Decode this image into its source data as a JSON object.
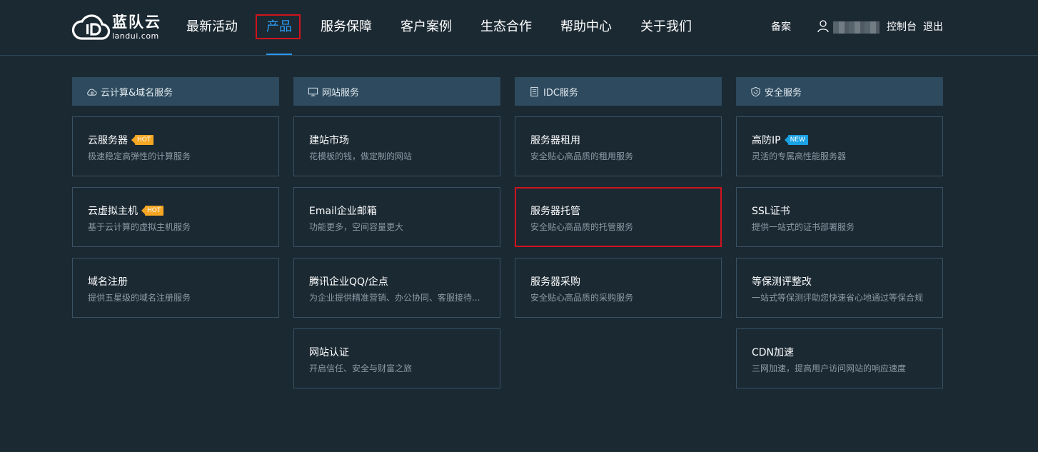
{
  "brand": {
    "name_cn": "蓝队云",
    "name_en": "landui.com"
  },
  "nav": {
    "items": [
      "最新活动",
      "产品",
      "服务保障",
      "客户案例",
      "生态合作",
      "帮助中心",
      "关于我们"
    ],
    "active": "产品"
  },
  "top_right": {
    "record": "备案",
    "console": "控制台",
    "logout": "退出"
  },
  "columns": [
    {
      "title": "云计算&域名服务",
      "icon": "cloud-gear-icon",
      "cards": [
        {
          "title": "云服务器",
          "desc": "极速稳定高弹性的计算服务",
          "tag": "HOT"
        },
        {
          "title": "云虚拟主机",
          "desc": "基于云计算的虚拟主机服务",
          "tag": "HOT"
        },
        {
          "title": "域名注册",
          "desc": "提供五星级的域名注册服务",
          "tag": ""
        }
      ]
    },
    {
      "title": "网站服务",
      "icon": "monitor-icon",
      "cards": [
        {
          "title": "建站市场",
          "desc": "花模板的钱，做定制的网站",
          "tag": ""
        },
        {
          "title": "Email企业邮箱",
          "desc": "功能更多，空间容量更大",
          "tag": ""
        },
        {
          "title": "腾讯企业QQ/企点",
          "desc": "为企业提供精准营销、办公协同、客服接待...",
          "tag": ""
        },
        {
          "title": "网站认证",
          "desc": "开启信任、安全与财富之旅",
          "tag": ""
        }
      ]
    },
    {
      "title": "IDC服务",
      "icon": "server-icon",
      "cards": [
        {
          "title": "服务器租用",
          "desc": "安全贴心高品质的租用服务",
          "tag": ""
        },
        {
          "title": "服务器托管",
          "desc": "安全贴心高品质的托管服务",
          "tag": ""
        },
        {
          "title": "服务器采购",
          "desc": "安全贴心高品质的采购服务",
          "tag": ""
        }
      ]
    },
    {
      "title": "安全服务",
      "icon": "shield-icon",
      "cards": [
        {
          "title": "高防IP",
          "desc": "灵活的专属高性能服务器",
          "tag": "NEW"
        },
        {
          "title": "SSL证书",
          "desc": "提供一站式的证书部署服务",
          "tag": ""
        },
        {
          "title": "等保测评整改",
          "desc": "一站式等保测评助您快速省心地通过等保合规",
          "tag": ""
        },
        {
          "title": "CDN加速",
          "desc": "三网加速，提高用户访问网站的响应速度",
          "tag": ""
        }
      ]
    }
  ],
  "colors": {
    "background": "#1b2933",
    "header_bg": "#2d4a5e",
    "accent": "#2c9af0",
    "highlight": "#d0141c",
    "hot": "#f5a623",
    "new": "#1aa1e4"
  }
}
